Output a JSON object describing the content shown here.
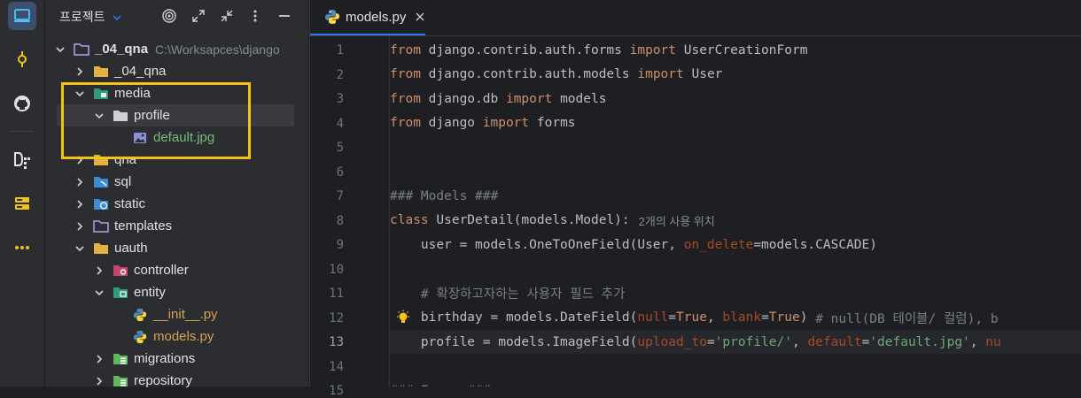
{
  "activity_bar": {
    "items": [
      {
        "name": "project-icon",
        "active": true
      },
      {
        "name": "commit-icon",
        "active": false
      },
      {
        "name": "github-icon",
        "active": false
      },
      {
        "name": "structure-icon",
        "active": false
      },
      {
        "name": "services-icon",
        "active": false
      },
      {
        "name": "more-icon",
        "active": false
      }
    ]
  },
  "project_panel": {
    "title": "프로젝트",
    "title_chevron": "chevron-down-icon",
    "header_icons": [
      "target-icon",
      "expand-icon",
      "collapse-icon",
      "more-vert-icon",
      "minimize-icon"
    ]
  },
  "tree": [
    {
      "label": "_04_qna",
      "path": "C:\\Worksapces\\django",
      "icon": "module-folder-icon",
      "expanded": true,
      "level": 0,
      "label_color": "#dfe1e5",
      "bold": true
    },
    {
      "label": "_04_qna",
      "icon": "folder-icon",
      "expanded": false,
      "level": 1,
      "label_color": "#dfe1e5"
    },
    {
      "label": "media",
      "icon": "resource-folder-icon",
      "expanded": true,
      "level": 1,
      "label_color": "#dfe1e5"
    },
    {
      "label": "profile",
      "icon": "folder-gray-icon",
      "expanded": true,
      "level": 2,
      "label_color": "#dfe1e5",
      "selected": true
    },
    {
      "label": "default.jpg",
      "icon": "image-file-icon",
      "level": 3,
      "label_color": "#73bd79"
    },
    {
      "label": "qna",
      "icon": "folder-icon",
      "expanded": false,
      "level": 1,
      "label_color": "#dfe1e5"
    },
    {
      "label": "sql",
      "icon": "sql-folder-icon",
      "expanded": false,
      "level": 1,
      "label_color": "#dfe1e5"
    },
    {
      "label": "static",
      "icon": "web-folder-icon",
      "expanded": false,
      "level": 1,
      "label_color": "#dfe1e5"
    },
    {
      "label": "templates",
      "icon": "folder-outline-icon",
      "expanded": false,
      "level": 1,
      "label_color": "#dfe1e5"
    },
    {
      "label": "uauth",
      "icon": "folder-icon",
      "expanded": true,
      "level": 1,
      "label_color": "#dfe1e5"
    },
    {
      "label": "controller",
      "icon": "controller-folder-icon",
      "expanded": false,
      "level": 2,
      "label_color": "#dfe1e5"
    },
    {
      "label": "entity",
      "icon": "entity-folder-icon",
      "expanded": true,
      "level": 2,
      "label_color": "#dfe1e5"
    },
    {
      "label": "__init__.py",
      "icon": "python-file-icon",
      "level": 3,
      "label_color": "#d5a553"
    },
    {
      "label": "models.py",
      "icon": "python-file-icon",
      "level": 3,
      "label_color": "#d5a553"
    },
    {
      "label": "migrations",
      "icon": "stack-folder-icon",
      "expanded": false,
      "level": 2,
      "label_color": "#dfe1e5"
    },
    {
      "label": "repository",
      "icon": "stack-folder-icon",
      "expanded": false,
      "level": 2,
      "label_color": "#dfe1e5"
    }
  ],
  "editor": {
    "tab": {
      "label": "models.py",
      "icon": "python-file-icon",
      "close": "close-icon"
    },
    "current_line": 13,
    "bulb_line": 12,
    "lines": [
      {
        "n": "1",
        "segs": [
          [
            "kw",
            "from"
          ],
          [
            "t",
            " django.contrib.auth.forms "
          ],
          [
            "kw",
            "import"
          ],
          [
            "t",
            " UserCreationForm"
          ]
        ]
      },
      {
        "n": "2",
        "segs": [
          [
            "kw",
            "from"
          ],
          [
            "t",
            " django.contrib.auth.models "
          ],
          [
            "kw",
            "import"
          ],
          [
            "t",
            " User"
          ]
        ]
      },
      {
        "n": "3",
        "segs": [
          [
            "kw",
            "from"
          ],
          [
            "t",
            " django.db "
          ],
          [
            "kw",
            "import"
          ],
          [
            "t",
            " models"
          ]
        ]
      },
      {
        "n": "4",
        "segs": [
          [
            "kw",
            "from"
          ],
          [
            "t",
            " django "
          ],
          [
            "kw",
            "import"
          ],
          [
            "t",
            " forms"
          ]
        ]
      },
      {
        "n": "5",
        "segs": []
      },
      {
        "n": "6",
        "segs": []
      },
      {
        "n": "7",
        "segs": [
          [
            "cm",
            "### Models ###"
          ]
        ]
      },
      {
        "n": "8",
        "segs": [
          [
            "kw",
            "class"
          ],
          [
            "t",
            " UserDetail(models.Model):"
          ]
        ],
        "inlay": "2개의 사용 위치"
      },
      {
        "n": "9",
        "segs": [
          [
            "t",
            "    user = models.OneToOneField(User, "
          ],
          [
            "prm",
            "on_delete"
          ],
          [
            "t",
            "=models.CASCADE)"
          ]
        ]
      },
      {
        "n": "10",
        "segs": []
      },
      {
        "n": "11",
        "segs": [
          [
            "cm",
            "    # 확장하고자하는 사용자 필드 추가"
          ]
        ]
      },
      {
        "n": "12",
        "segs": [
          [
            "t",
            "    birthday = models.DateField("
          ],
          [
            "prm",
            "null"
          ],
          [
            "t",
            "="
          ],
          [
            "kw",
            "True"
          ],
          [
            "t",
            ", "
          ],
          [
            "prm",
            "blank"
          ],
          [
            "t",
            "="
          ],
          [
            "kw",
            "True"
          ],
          [
            "t",
            ") "
          ],
          [
            "cm",
            "# null(DB 테이블/ 컬럼), b"
          ]
        ]
      },
      {
        "n": "13",
        "segs": [
          [
            "t",
            "    profile = models.ImageField("
          ],
          [
            "prm",
            "upload_to"
          ],
          [
            "t",
            "="
          ],
          [
            "str",
            "'profile/'"
          ],
          [
            "t",
            ", "
          ],
          [
            "prm",
            "default"
          ],
          [
            "t",
            "="
          ],
          [
            "str",
            "'default.jpg'"
          ],
          [
            "t",
            ", "
          ],
          [
            "prm",
            "nu"
          ]
        ]
      },
      {
        "n": "14",
        "segs": []
      },
      {
        "n": "15",
        "segs": [
          [
            "cm",
            "### Forms ###"
          ]
        ]
      }
    ]
  },
  "colors": {
    "accent": "#3574f0",
    "highlight_box": "#f2c417",
    "keyword": "#cf8e6d",
    "string": "#6aab73",
    "param": "#aa4926",
    "comment": "#7a7e85"
  }
}
